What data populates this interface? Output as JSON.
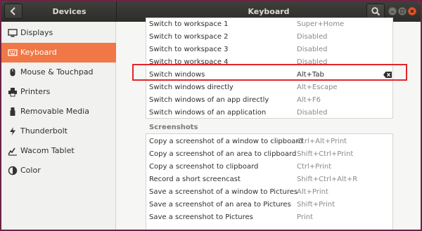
{
  "header": {
    "left_title": "Devices",
    "title": "Keyboard",
    "back_icon": "chevron-left-icon",
    "search_icon": "search-icon"
  },
  "sidebar": {
    "items": [
      {
        "label": "Displays",
        "icon": "display-icon",
        "active": false
      },
      {
        "label": "Keyboard",
        "icon": "keyboard-icon",
        "active": true
      },
      {
        "label": "Mouse & Touchpad",
        "icon": "mouse-icon",
        "active": false
      },
      {
        "label": "Printers",
        "icon": "printer-icon",
        "active": false
      },
      {
        "label": "Removable Media",
        "icon": "usb-icon",
        "active": false
      },
      {
        "label": "Thunderbolt",
        "icon": "thunderbolt-icon",
        "active": false
      },
      {
        "label": "Wacom Tablet",
        "icon": "tablet-icon",
        "active": false
      },
      {
        "label": "Color",
        "icon": "color-icon",
        "active": false
      }
    ]
  },
  "navigation_rows": [
    {
      "name": "Switch to workspace 1",
      "accel": "Super+Home"
    },
    {
      "name": "Switch to workspace 2",
      "accel": "Disabled"
    },
    {
      "name": "Switch to workspace 3",
      "accel": "Disabled"
    },
    {
      "name": "Switch to workspace 4",
      "accel": "Disabled"
    },
    {
      "name": "Switch windows",
      "accel": "Alt+Tab",
      "selected": true
    },
    {
      "name": "Switch windows directly",
      "accel": "Alt+Escape"
    },
    {
      "name": "Switch windows of an app directly",
      "accel": "Alt+F6"
    },
    {
      "name": "Switch windows of an application",
      "accel": "Disabled"
    }
  ],
  "screenshots": {
    "title": "Screenshots",
    "rows": [
      {
        "name": "Copy a screenshot of a window to clipboard",
        "accel": "Ctrl+Alt+Print"
      },
      {
        "name": "Copy a screenshot of an area to clipboard",
        "accel": "Shift+Ctrl+Print"
      },
      {
        "name": "Copy a screenshot to clipboard",
        "accel": "Ctrl+Print"
      },
      {
        "name": "Record a short screencast",
        "accel": "Shift+Ctrl+Alt+R"
      },
      {
        "name": "Save a screenshot of a window to Pictures",
        "accel": "Alt+Print"
      },
      {
        "name": "Save a screenshot of an area to Pictures",
        "accel": "Shift+Print"
      },
      {
        "name": "Save a screenshot to Pictures",
        "accel": "Print"
      }
    ]
  },
  "colors": {
    "accent": "#f07746",
    "highlight_border": "#e3252b",
    "headerbar": "#3a3a37",
    "close_button": "#e2572e"
  }
}
